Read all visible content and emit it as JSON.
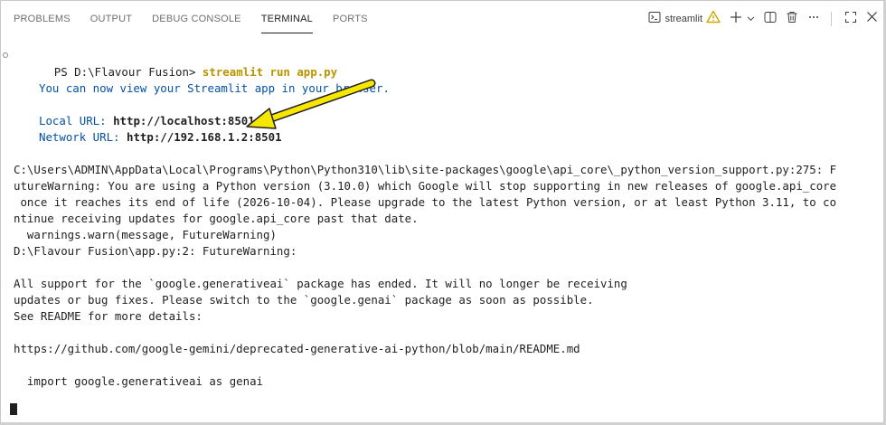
{
  "tabs": {
    "problems": "PROBLEMS",
    "output": "OUTPUT",
    "debug_console": "DEBUG CONSOLE",
    "terminal": "TERMINAL",
    "ports": "PORTS"
  },
  "terminal_instance": {
    "name": "streamlit",
    "warning_icon": "warning-icon",
    "shell_icon": "terminal-icon"
  },
  "toolbar_icons": [
    "add-terminal-icon",
    "chevron-down-icon",
    "split-icon",
    "trash-icon",
    "more-icon",
    "maximize-icon",
    "close-icon"
  ],
  "colors": {
    "url_blue": "#0451a5",
    "command_yellow": "#b89500",
    "arrow_yellow": "#f6e600",
    "warning_orange": "#cca700"
  },
  "lines": {
    "prompt": "PS D:\\Flavour Fusion> ",
    "command": "streamlit run app.py",
    "view_msg": "You can now view your Streamlit app in your browser.",
    "local_label": "Local URL: ",
    "local_url": "http://localhost:8501",
    "network_label": "Network URL: ",
    "network_url": "http://192.168.1.2:8501",
    "warn1": "C:\\Users\\ADMIN\\AppData\\Local\\Programs\\Python\\Python310\\lib\\site-packages\\google\\api_core\\_python_version_support.py:275: F",
    "warn2": "utureWarning: You are using a Python version (3.10.0) which Google will stop supporting in new releases of google.api_core",
    "warn3": " once it reaches its end of life (2026-10-04). Please upgrade to the latest Python version, or at least Python 3.11, to co",
    "warn4": "ntinue receiving updates for google.api_core past that date.",
    "warn5": "  warnings.warn(message, FutureWarning)",
    "warn6": "D:\\Flavour Fusion\\app.py:2: FutureWarning:",
    "support1": "All support for the `google.generativeai` package has ended. It will no longer be receiving",
    "support2": "updates or bug fixes. Please switch to the `google.genai` package as soon as possible.",
    "support3": "See README for more details:",
    "readme_url": "https://github.com/google-gemini/deprecated-generative-ai-python/blob/main/README.md",
    "import_line": "  import google.generativeai as genai"
  }
}
